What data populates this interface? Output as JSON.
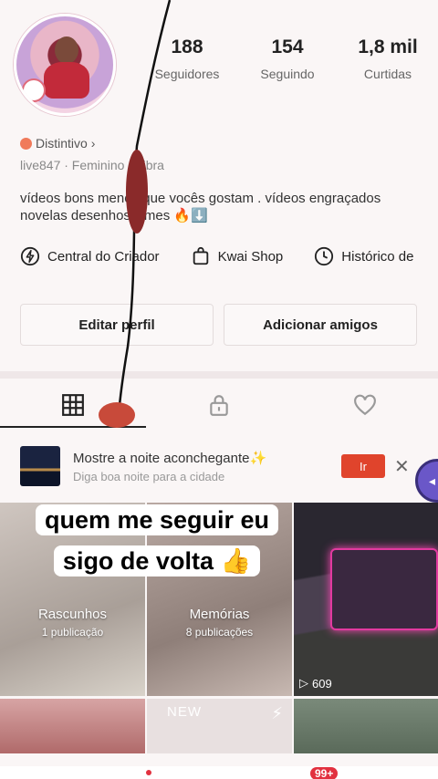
{
  "profile": {
    "stats": [
      {
        "value": "188",
        "label": "Seguidores"
      },
      {
        "value": "154",
        "label": "Seguindo"
      },
      {
        "value": "1,8 mil",
        "label": "Curtidas"
      }
    ],
    "badge": "Distintivo",
    "meta": "live847 · Feminino · Libra",
    "bio_line1": "vídeos bons menos que vocês gostam . vídeos engraçados",
    "bio_line2": "novelas desenhos filmes 🔥⬇️"
  },
  "tools": [
    {
      "label": "Central do Criador",
      "icon": "lightning-circle-icon"
    },
    {
      "label": "Kwai Shop",
      "icon": "shopping-bag-icon"
    },
    {
      "label": "Histórico de",
      "icon": "clock-icon"
    }
  ],
  "buttons": {
    "edit": "Editar perfil",
    "add": "Adicionar amigos"
  },
  "promo": {
    "title": "Mostre a noite aconchegante✨",
    "subtitle": "Diga boa noite para a cidade",
    "go": "Ir",
    "close": "✕"
  },
  "grid": {
    "drafts": {
      "name": "Rascunhos",
      "count": "1 publicação"
    },
    "memories": {
      "name": "Memórias",
      "count": "8 publicações"
    },
    "video_views": "609",
    "new_tag": "NEW"
  },
  "caption": {
    "line1": "quem me seguir eu",
    "line2": "sigo de volta 👍"
  },
  "nav": {
    "notifications": "99+"
  },
  "colors": {
    "accent": "#e0442c",
    "badge": "#e2313f",
    "float": "#6a57c8"
  }
}
